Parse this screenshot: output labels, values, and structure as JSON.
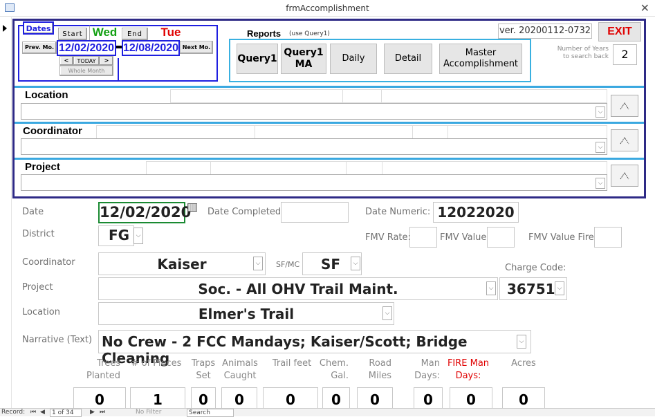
{
  "window": {
    "title": "frmAccomplishment"
  },
  "dates": {
    "legend": "Dates",
    "start_label": "Start",
    "start_day": "Wed",
    "end_label": "End",
    "end_day": "Tue",
    "prev_label": "Prev. Mo.",
    "start_date": "12/02/2020",
    "end_date": "12/08/2020",
    "next_label": "Next Mo.",
    "back_label": "<",
    "today_label": "TODAY",
    "fwd_label": ">",
    "whole_month_label": "Whole Month"
  },
  "reports": {
    "title": "Reports",
    "subtitle": "(use Query1)",
    "buttons": [
      "Query1",
      "Query1\nMA",
      "Daily",
      "Detail",
      "Master\nAccomplishment"
    ]
  },
  "version": "ver. 20200112-0732",
  "exit_label": "EXIT",
  "years_back": {
    "label": "Number of Years\nto search back",
    "value": "2"
  },
  "filters": {
    "location_label": "Location",
    "coordinator_label": "Coordinator",
    "project_label": "Project"
  },
  "form": {
    "date_label": "Date",
    "date_value": "12/02/2020",
    "date_completed_label": "Date Completed",
    "date_numeric_label": "Date Numeric:",
    "date_numeric_value": "12022020",
    "district_label": "District",
    "district_value": "FG",
    "fmv_rate_label": "FMV Rate:",
    "fmv_value_label": "FMV Value:",
    "fmv_value_fire_label": "FMV Value Fire:",
    "coordinator_label": "Coordinator",
    "coordinator_value": "Kaiser",
    "sfmc_label": "SF/MC",
    "sfmc_value": "SF",
    "charge_code_label": "Charge Code:",
    "project_label": "Project",
    "project_value": "Soc. - All OHV Trail Maint.",
    "charge_code_value": "36751",
    "location_label": "Location",
    "location_value": "Elmer's Trail",
    "narrative_label": "Narrative (Text)",
    "narrative_value": "No Crew - 2 FCC Mandays; Kaiser/Scott; Bridge Cleaning"
  },
  "metrics": [
    {
      "label": "Trees\nPlanted",
      "value": "0"
    },
    {
      "label": "# of Pieces",
      "value": "1"
    },
    {
      "label": "Traps\nSet",
      "value": "0"
    },
    {
      "label": "Animals\nCaught",
      "value": "0"
    },
    {
      "label": "Trail feet",
      "value": "0"
    },
    {
      "label": "Chem.\nGal.",
      "value": "0"
    },
    {
      "label": "Road\nMiles",
      "value": "0"
    },
    {
      "label": "Man\nDays:",
      "value": "0"
    },
    {
      "label": "FIRE Man\nDays:",
      "value": "0"
    },
    {
      "label": "Acres",
      "value": "0"
    }
  ],
  "colors": {
    "fire_label": "#e00000",
    "header_border": "#2e2a86",
    "accent_blue": "#1f1fe0",
    "separator": "#3aa8e0"
  },
  "navigation": {
    "record_label": "Record:",
    "record_position": "1 of 34",
    "filter_label": "No Filter",
    "search_label": "Search"
  }
}
